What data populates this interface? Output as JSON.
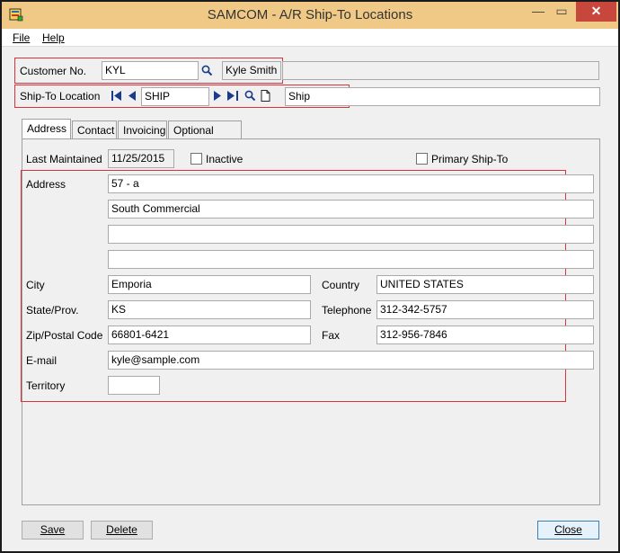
{
  "window": {
    "title": "SAMCOM - A/R Ship-To Locations",
    "min": "▭",
    "close": "✕"
  },
  "menu": {
    "file": "File",
    "help": "Help"
  },
  "customer": {
    "label": "Customer No.",
    "value": "KYL",
    "name": "Kyle Smith"
  },
  "shipto": {
    "label": "Ship-To Location",
    "value": "SHIP",
    "description": "Ship"
  },
  "tabs": [
    "Address",
    "Contact",
    "Invoicing",
    "Optional Fields"
  ],
  "address_tab": {
    "last_maintained_label": "Last Maintained",
    "last_maintained": "11/25/2015",
    "inactive_label": "Inactive",
    "primary_label": "Primary Ship-To",
    "address_label": "Address",
    "address_lines": [
      "57 - a",
      "South Commercial",
      "",
      ""
    ],
    "city_label": "City",
    "city": "Emporia",
    "country_label": "Country",
    "country": "UNITED STATES",
    "state_label": "State/Prov.",
    "state": "KS",
    "telephone_label": "Telephone",
    "telephone": "312-342-5757",
    "zip_label": "Zip/Postal Code",
    "zip": "66801-6421",
    "fax_label": "Fax",
    "fax": "312-956-7846",
    "email_label": "E-mail",
    "email": "kyle@sample.com",
    "territory_label": "Territory",
    "territory": ""
  },
  "buttons": {
    "save": "Save",
    "delete": "Delete",
    "close": "Close"
  },
  "icons": {
    "first": "first-icon",
    "prev": "previous-icon",
    "next": "next-icon",
    "last": "last-icon",
    "finder": "search-icon",
    "new": "new-document-icon"
  }
}
